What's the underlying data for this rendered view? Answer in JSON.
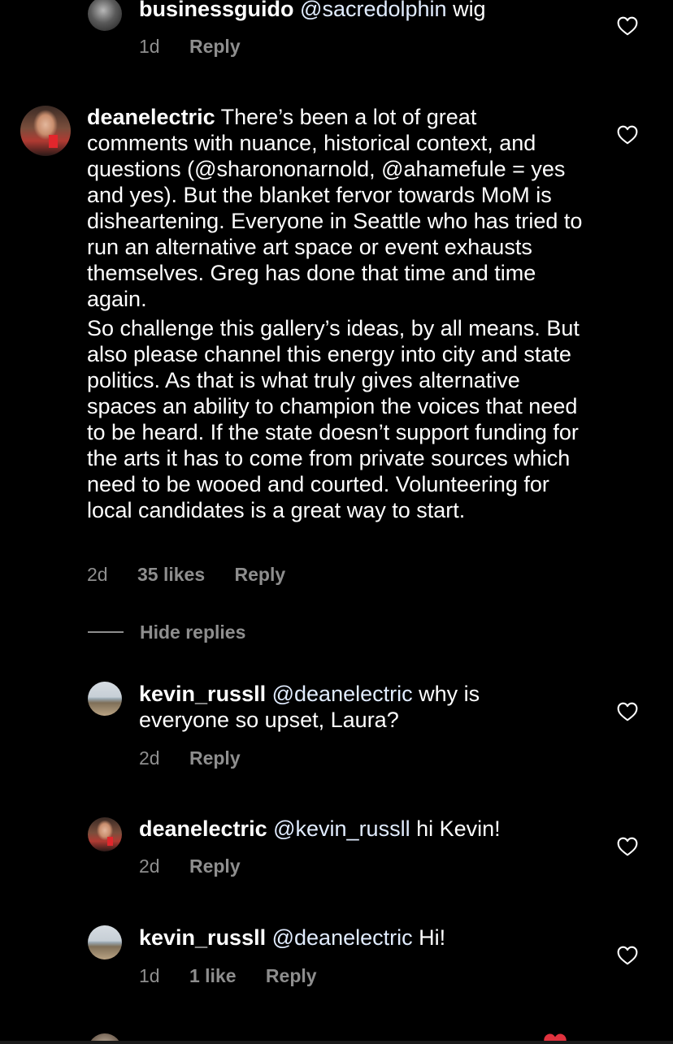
{
  "comments": [
    {
      "username": "businessguido",
      "mention": "@sacredolphin",
      "text_paragraphs": [
        " wig"
      ],
      "time": "1d",
      "likes": "",
      "reply_label": "Reply"
    },
    {
      "username": "deanelectric",
      "text_paragraphs": [
        "There’s been a lot of great comments with nuance, historical context, and questions (@sharononarnold, @ahamefule = yes and yes). But the blanket fervor towards MoM is disheartening. Everyone in Seattle who has tried to run an alternative art space or event exhausts themselves. Greg has done that time and time again.",
        "So challenge this gallery’s ideas, by all means. But also please channel this energy into city and state politics. As that is what truly gives alternative spaces an ability to champion the voices that need to be heard. If the state doesn’t support funding for the arts it has to come from private sources which need to be wooed and courted. Volunteering for local candidates is a great way to start."
      ],
      "time": "2d",
      "likes": "35 likes",
      "reply_label": "Reply"
    }
  ],
  "hide_replies_label": "Hide replies",
  "replies": [
    {
      "username": "kevin_russll",
      "mention": "@deanelectric",
      "text": " why is everyone so upset, Laura?",
      "time": "2d",
      "likes": "",
      "reply_label": "Reply"
    },
    {
      "username": "deanelectric",
      "mention": "@kevin_russll",
      "text": " hi Kevin!",
      "time": "2d",
      "likes": "",
      "reply_label": "Reply"
    },
    {
      "username": "kevin_russll",
      "mention": "@deanelectric",
      "text": " Hi!",
      "time": "1d",
      "likes": "1 like",
      "reply_label": "Reply"
    }
  ],
  "icons": {
    "like": "heart-outline-icon",
    "emoji": "red-heart-emoji"
  },
  "colors": {
    "background": "#000000",
    "text": "#ffffff",
    "secondary": "#8e8e8e",
    "mention": "#e1ecff"
  }
}
